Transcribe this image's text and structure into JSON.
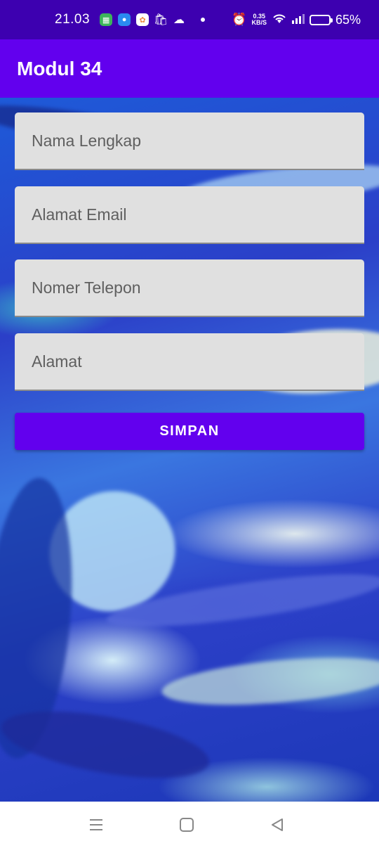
{
  "status_bar": {
    "time": "21.03",
    "net_speed_value": "0.35",
    "net_speed_unit": "KB/S",
    "battery": "65%",
    "battery_level": 0.65,
    "icons": [
      "calculator-icon",
      "chat-bubble-icon",
      "photos-icon",
      "shopping-bag-icon",
      "cloud-icon",
      "alarm-icon",
      "wifi-icon",
      "signal-icon",
      "battery-icon"
    ]
  },
  "app_bar": {
    "title": "Modul 34"
  },
  "form": {
    "fields": [
      {
        "placeholder": "Nama Lengkap",
        "value": ""
      },
      {
        "placeholder": "Alamat Email",
        "value": ""
      },
      {
        "placeholder": "Nomer Telepon",
        "value": ""
      },
      {
        "placeholder": "Alamat",
        "value": ""
      }
    ],
    "submit_label": "SIMPAN"
  },
  "nav_bar": {
    "buttons": [
      "menu-icon",
      "home-icon",
      "back-icon"
    ]
  },
  "colors": {
    "status_bar": "#3d00b0",
    "app_bar": "#6200ee",
    "button": "#6200ee",
    "field_bg": "#e0e0e0"
  }
}
